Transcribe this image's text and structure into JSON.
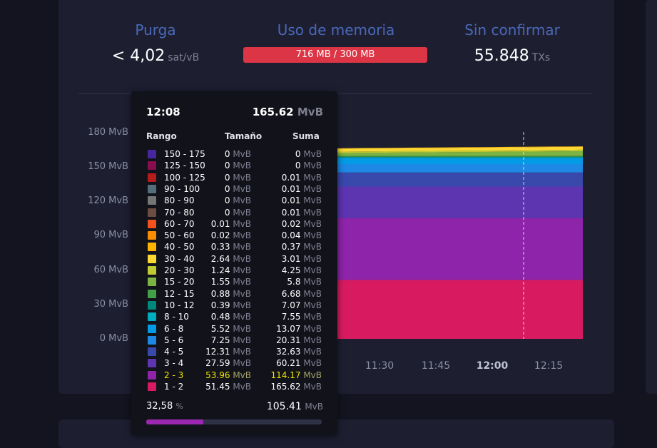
{
  "header": {
    "purga": {
      "title": "Purga",
      "value": "< 4,02",
      "unit": "sat/vB"
    },
    "memoria": {
      "title": "Uso de memoria",
      "value": "716 MB / 300 MB",
      "bar_color": "#dc3545"
    },
    "sin_confirmar": {
      "title": "Sin confirmar",
      "value": "55.848",
      "unit": "TXs"
    }
  },
  "chart": {
    "y_labels": [
      "180 MvB",
      "150 MvB",
      "120 MvB",
      "90 MvB",
      "60 MvB",
      "30 MvB",
      "0 MvB"
    ],
    "x_labels": [
      "11:30",
      "11:45",
      "12:00",
      "12:15"
    ],
    "bold_x_label": "12:00"
  },
  "chart_data": {
    "type": "area",
    "stacked": true,
    "x": [
      "12:08"
    ],
    "ylim": [
      0,
      180
    ],
    "y_unit": "MvB",
    "series": [
      {
        "name": "1 - 2",
        "color": "#d81b60",
        "values": [
          51.45
        ]
      },
      {
        "name": "2 - 3",
        "color": "#8e24aa",
        "values": [
          53.96
        ]
      },
      {
        "name": "3 - 4",
        "color": "#5e35b1",
        "values": [
          27.59
        ]
      },
      {
        "name": "4 - 5",
        "color": "#3949ab",
        "values": [
          12.31
        ]
      },
      {
        "name": "5 - 6",
        "color": "#1e88e5",
        "values": [
          7.25
        ]
      },
      {
        "name": "6 - 8",
        "color": "#039be5",
        "values": [
          5.52
        ]
      },
      {
        "name": "8 - 10",
        "color": "#00acc1",
        "values": [
          0.48
        ]
      },
      {
        "name": "10 - 12",
        "color": "#00897b",
        "values": [
          0.39
        ]
      },
      {
        "name": "12 - 15",
        "color": "#43a047",
        "values": [
          0.88
        ]
      },
      {
        "name": "15 - 20",
        "color": "#7cb342",
        "values": [
          1.55
        ]
      },
      {
        "name": "20 - 30",
        "color": "#c0ca33",
        "values": [
          1.24
        ]
      },
      {
        "name": "30 - 40",
        "color": "#fdd835",
        "values": [
          2.64
        ]
      },
      {
        "name": "40 - 50",
        "color": "#ffb300",
        "values": [
          0.33
        ]
      }
    ]
  },
  "tooltip": {
    "time": "12:08",
    "total": "165.62",
    "total_unit": "MvB",
    "headers": {
      "range": "Rango",
      "size": "Tamaño",
      "sum": "Suma"
    },
    "unit": "MvB",
    "rows": [
      {
        "range": "150 - 175",
        "size": "0",
        "sum": "0",
        "color": "#4527a0"
      },
      {
        "range": "125 - 150",
        "size": "0",
        "sum": "0",
        "color": "#880e4f"
      },
      {
        "range": "100 - 125",
        "size": "0",
        "sum": "0.01",
        "color": "#b71c1c"
      },
      {
        "range": "90 - 100",
        "size": "0",
        "sum": "0.01",
        "color": "#546e7a"
      },
      {
        "range": "80 - 90",
        "size": "0",
        "sum": "0.01",
        "color": "#757575"
      },
      {
        "range": "70 - 80",
        "size": "0",
        "sum": "0.01",
        "color": "#6d4c41"
      },
      {
        "range": "60 - 70",
        "size": "0.01",
        "sum": "0.02",
        "color": "#f4511e"
      },
      {
        "range": "50 - 60",
        "size": "0.02",
        "sum": "0.04",
        "color": "#fb8c00"
      },
      {
        "range": "40 - 50",
        "size": "0.33",
        "sum": "0.37",
        "color": "#ffb300"
      },
      {
        "range": "30 - 40",
        "size": "2.64",
        "sum": "3.01",
        "color": "#fdd835"
      },
      {
        "range": "20 - 30",
        "size": "1.24",
        "sum": "4.25",
        "color": "#c0ca33"
      },
      {
        "range": "15 - 20",
        "size": "1.55",
        "sum": "5.8",
        "color": "#7cb342"
      },
      {
        "range": "12 - 15",
        "size": "0.88",
        "sum": "6.68",
        "color": "#43a047"
      },
      {
        "range": "10 - 12",
        "size": "0.39",
        "sum": "7.07",
        "color": "#00897b"
      },
      {
        "range": "8 - 10",
        "size": "0.48",
        "sum": "7.55",
        "color": "#00acc1"
      },
      {
        "range": "6 - 8",
        "size": "5.52",
        "sum": "13.07",
        "color": "#039be5"
      },
      {
        "range": "5 - 6",
        "size": "7.25",
        "sum": "20.31",
        "color": "#1e88e5"
      },
      {
        "range": "4 - 5",
        "size": "12.31",
        "sum": "32.63",
        "color": "#3949ab"
      },
      {
        "range": "3 - 4",
        "size": "27.59",
        "sum": "60.21",
        "color": "#5e35b1"
      },
      {
        "range": "2 - 3",
        "size": "53.96",
        "sum": "114.17",
        "color": "#8e24aa",
        "highlight": true
      },
      {
        "range": "1 - 2",
        "size": "51.45",
        "sum": "165.62",
        "color": "#d81b60"
      }
    ],
    "percent": "32,58",
    "percent_sign": "%",
    "vbytes": "105.41",
    "vbytes_unit": "MvB",
    "progress_fraction": 0.3258,
    "progress_color": "#9c27b0"
  }
}
